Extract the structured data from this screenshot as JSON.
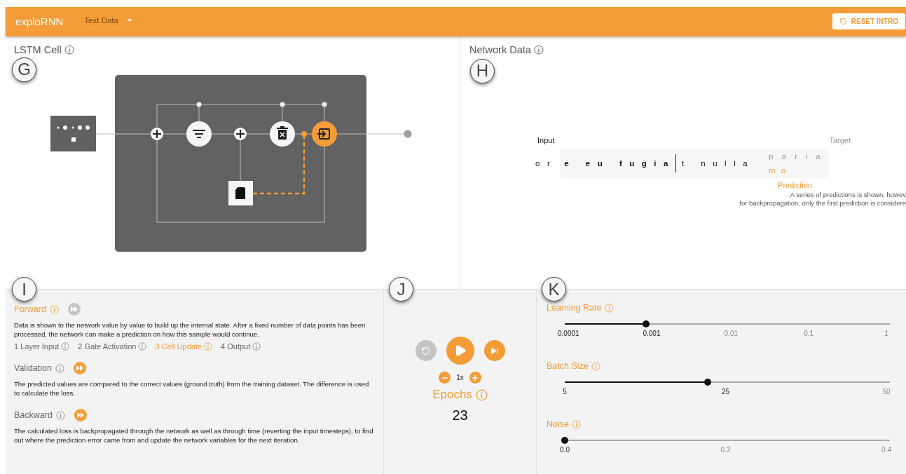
{
  "app_bar": {
    "title": "exploRNN",
    "dataset_select": {
      "value": "Text Data"
    },
    "reset_button": "RESET INTRO"
  },
  "lstm_panel": {
    "title": "LSTM Cell",
    "marker": "G"
  },
  "network_panel": {
    "title": "Network Data",
    "marker": "H",
    "input_label": "Input",
    "input_history": "or",
    "input_window": "e eu fugia",
    "input_ahead": "t nulla",
    "target_label": "Target",
    "target": "paria",
    "prediction": "mo",
    "prediction_label": "Prediction",
    "note": [
      "A series of predictions is shown, howev",
      "for backpropagation, only the first prediction is considere"
    ]
  },
  "training_panel": {
    "marker": "I",
    "sections": [
      {
        "title": "Forward",
        "active": true,
        "skip_disabled": true,
        "description": "Data is shown to the network value by value to build up the internal state. After a fixed number of data points has been processed, the network can make a prediction on how this sample would continue.",
        "steps": [
          {
            "label": "1 Layer Input",
            "selected": false
          },
          {
            "label": "2 Gate Activation",
            "selected": false
          },
          {
            "label": "3 Cell Update",
            "selected": true
          },
          {
            "label": "4 Output",
            "selected": false
          }
        ]
      },
      {
        "title": "Validation",
        "active": false,
        "skip_disabled": false,
        "description": "The predicted values are compared to the correct values (ground truth) from the training dataset. The difference is used to calculate the loss."
      },
      {
        "title": "Backward",
        "active": false,
        "skip_disabled": false,
        "description": "The calculated loss is backpropagated through the network as well as through time (reverting the input timesteps), to find out where the prediction error came from and update the network variables for the next iteration."
      }
    ]
  },
  "playback": {
    "marker": "J",
    "buttons": [
      {
        "kind": "reset",
        "disabled": true
      },
      {
        "kind": "play",
        "disabled": false
      },
      {
        "kind": "step",
        "disabled": false
      }
    ],
    "speed": "1x",
    "epochs_label": "Epochs",
    "epochs": "23"
  },
  "parameters": {
    "marker": "K",
    "sliders": [
      {
        "label": "Learning Rate",
        "level": 0.25,
        "ticks": [
          {
            "label": "0.0001",
            "active": true
          },
          {
            "label": "0.001",
            "active": true
          },
          {
            "label": "0.01",
            "active": false
          },
          {
            "label": "0.1",
            "active": false
          },
          {
            "label": "1",
            "active": false
          }
        ]
      },
      {
        "label": "Batch Size",
        "level": 0.44,
        "ticks": [
          {
            "label": "5",
            "active": true
          },
          {
            "label": "25",
            "active": true
          },
          {
            "label": "50",
            "active": false
          }
        ]
      },
      {
        "label": "Noise",
        "level": 0,
        "ticks": [
          {
            "label": "0.0",
            "active": true
          },
          {
            "label": "0.2",
            "active": false
          },
          {
            "label": "0.4",
            "active": false
          }
        ]
      }
    ]
  }
}
